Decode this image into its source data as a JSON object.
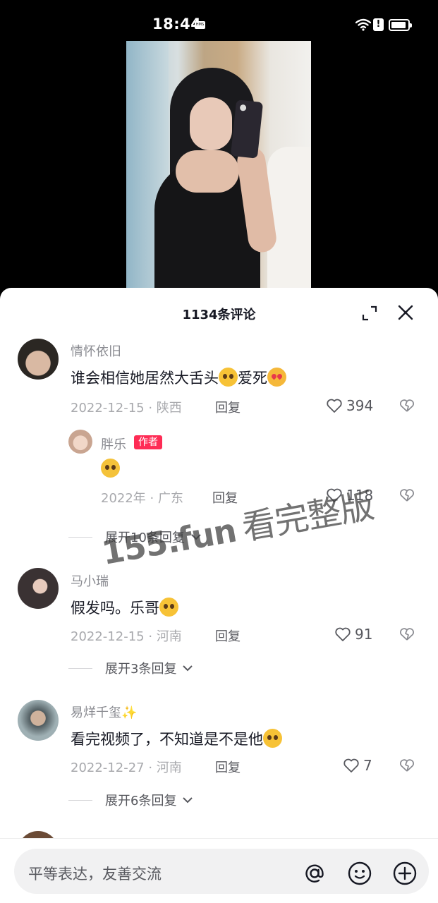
{
  "status_bar": {
    "time": "18:44",
    "hms_badge": "HMS",
    "alert_glyph": "!"
  },
  "sheet": {
    "title": "1134条评论"
  },
  "comments": [
    {
      "user": "情怀依旧",
      "text_a": "谁会相信她居然大舌头",
      "text_b": "爱死",
      "date": "2022-12-15 · 陕西",
      "reply_label": "回复",
      "likes": "394"
    },
    {
      "user": "胖乐",
      "badge": "作者",
      "date": "2022年 · 广东",
      "reply_label": "回复",
      "likes": "118",
      "expand": "展开10条回复"
    },
    {
      "user": "马小瑞",
      "text": "假发吗。乐哥",
      "date": "2022-12-15 · 河南",
      "reply_label": "回复",
      "likes": "91",
      "expand": "展开3条回复"
    },
    {
      "user": "易烊千玺✨",
      "text": "看完视频了，不知道是不是他",
      "date": "2022-12-27 · 河南",
      "reply_label": "回复",
      "likes": "7",
      "expand": "展开6条回复"
    }
  ],
  "watermark": {
    "domain": "155.fun",
    "text": "看完整版"
  },
  "input": {
    "placeholder": "平等表达，友善交流"
  },
  "icons": [
    "expand-icon",
    "close-icon",
    "heart-icon",
    "broken-heart-icon",
    "chevron-down-icon",
    "at-icon",
    "emoji-icon",
    "plus-icon"
  ]
}
